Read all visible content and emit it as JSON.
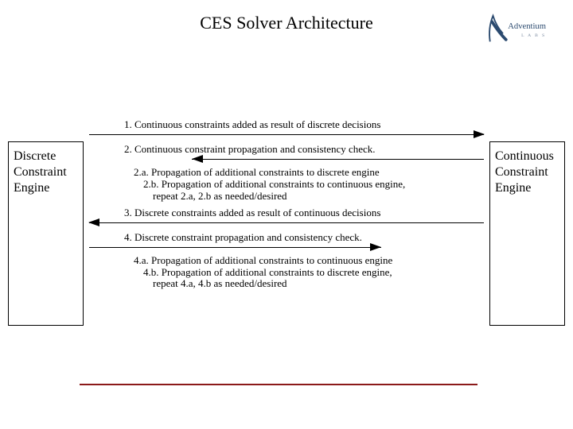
{
  "title": "CES Solver Architecture",
  "logo": {
    "brand": "Adventium",
    "sub": "L  A  B  S"
  },
  "left_box": "Discrete\nConstraint\nEngine",
  "right_box": "Continuous\nConstraint\nEngine",
  "steps": {
    "s1": "1. Continuous constraints added as result of discrete decisions",
    "s2": "2. Continuous constraint propagation and consistency check.",
    "s2a": "2.a. Propagation of additional constraints to discrete engine",
    "s2b": "2.b. Propagation of additional constraints to continuous engine,",
    "s2c": "repeat 2.a, 2.b as needed/desired",
    "s3": "3. Discrete constraints added as result of continuous decisions",
    "s4": "4. Discrete constraint propagation and consistency check.",
    "s4a": "4.a. Propagation of additional constraints to continuous engine",
    "s4b": "4.b. Propagation of additional constraints to discrete engine,",
    "s4c": "repeat 4.a, 4.b as needed/desired"
  }
}
